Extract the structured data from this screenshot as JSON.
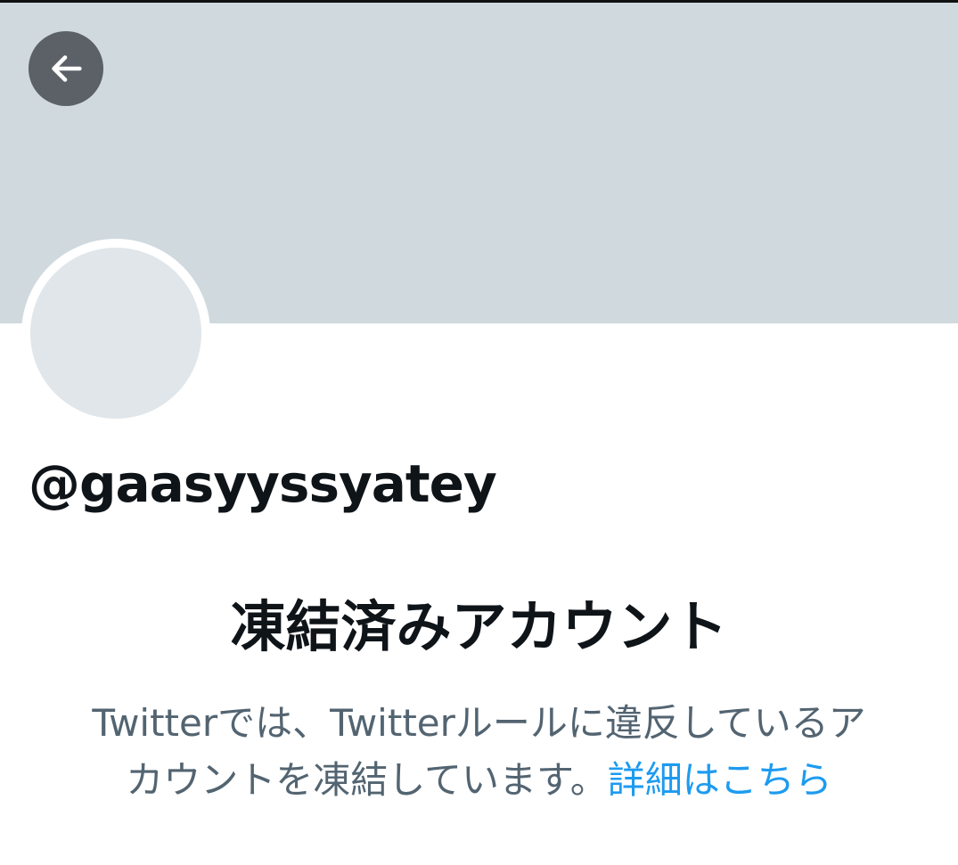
{
  "profile": {
    "handle": "@gaasyyssyatey",
    "status_title": "凍結済みアカウント",
    "description_line1": "Twitterでは、Twitterルールに違反しているア",
    "description_line2": "カウントを凍結しています。",
    "learn_more_label": "詳細はこちら"
  },
  "header": {
    "back_icon": "arrow-left-icon"
  },
  "colors": {
    "banner": "#cfd9de",
    "avatar": "#e0e6ea",
    "back_button_bg": "#5b6166",
    "primary_text": "#0f1419",
    "secondary_text": "#536471",
    "link": "#1d9bf0"
  }
}
